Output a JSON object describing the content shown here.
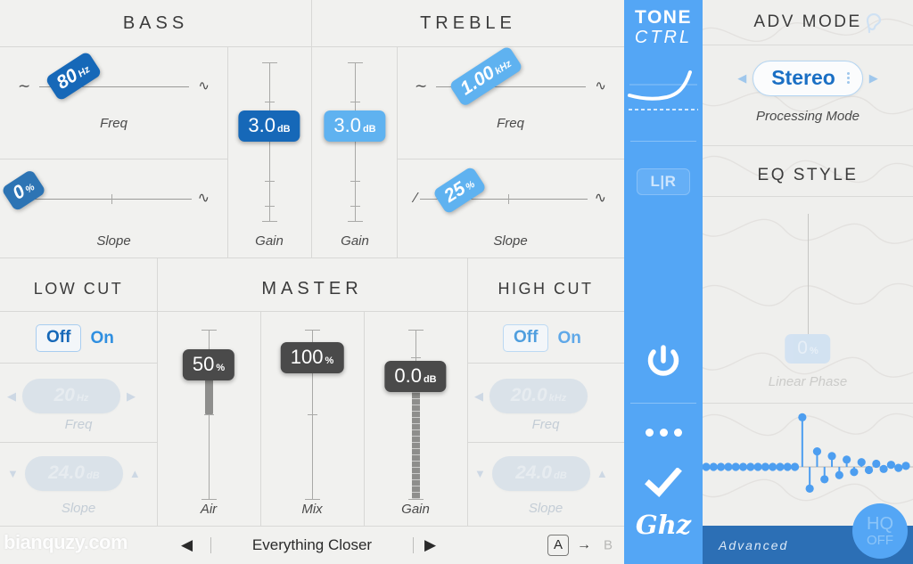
{
  "bass": {
    "title": "BASS",
    "freq": {
      "value": "80",
      "unit": "Hz",
      "label": "Freq",
      "pos_pct": 18
    },
    "slope": {
      "value": "0",
      "unit": "%",
      "label": "Slope",
      "pos_pct": 1
    },
    "gain": {
      "value": "3.0",
      "unit": "dB",
      "label": "Gain",
      "pos_pct": 62
    },
    "accent": "#1668b8"
  },
  "treble": {
    "title": "TREBLE",
    "freq": {
      "value": "1.00",
      "unit": "kHz",
      "label": "Freq",
      "pos_pct": 25
    },
    "slope": {
      "value": "25",
      "unit": "%",
      "label": "Slope",
      "pos_pct": 24
    },
    "gain": {
      "value": "3.0",
      "unit": "dB",
      "label": "Gain",
      "pos_pct": 62
    },
    "accent": "#5fb2f0"
  },
  "lowcut": {
    "title": "LOW CUT",
    "toggle": {
      "off": "Off",
      "on": "On",
      "selected": "Off"
    },
    "freq": {
      "value": "20",
      "unit": "Hz",
      "label": "Freq",
      "left_arrow": "◀",
      "right_arrow": "▶"
    },
    "slope": {
      "value": "24.0",
      "unit": "dB",
      "label": "Slope",
      "left_arrow": "▼",
      "right_arrow": "▲"
    }
  },
  "highcut": {
    "title": "HIGH CUT",
    "toggle": {
      "off": "Off",
      "on": "On",
      "selected": "Off"
    },
    "freq": {
      "value": "20.0",
      "unit": "kHz",
      "label": "Freq",
      "left_arrow": "◀",
      "right_arrow": "▶"
    },
    "slope": {
      "value": "24.0",
      "unit": "dB",
      "label": "Slope",
      "left_arrow": "▼",
      "right_arrow": "▲"
    }
  },
  "master": {
    "title": "MASTER",
    "accent": "#4a4a4a",
    "air": {
      "value": "50",
      "unit": "%",
      "label": "Air",
      "pos_pct": 50
    },
    "mix": {
      "value": "100",
      "unit": "%",
      "label": "Mix",
      "pos_pct": 100
    },
    "gain": {
      "value": "0.0",
      "unit": "dB",
      "label": "Gain",
      "pos_pct": 84
    }
  },
  "center": {
    "title_line1": "TONE",
    "title_line2": "CTRL",
    "lr_button": "L|R",
    "power_icon": "power-icon",
    "menu_icon": "more-dots-icon",
    "check_icon": "checkmark-icon",
    "logo": "Ghz",
    "bg": "#54a6f5"
  },
  "advmode": {
    "title": "ADV MODE",
    "ear_icon": "ear-icon",
    "mode_value": "Stereo",
    "mode_label": "Processing Mode",
    "left_arrow": "◀",
    "right_arrow": "▶"
  },
  "eqstyle": {
    "title": "EQ STYLE",
    "linear_phase": {
      "value": "0",
      "unit": "%",
      "label": "Linear Phase"
    }
  },
  "impulse": {
    "label": "impulse-response-plot",
    "dot_color": "#4d9ef0",
    "stems": [
      0,
      0,
      0,
      0,
      0,
      0,
      0,
      0,
      0,
      0,
      0,
      0,
      0,
      0.96,
      -0.42,
      0.3,
      -0.24,
      0.21,
      -0.16,
      0.14,
      -0.1,
      0.09,
      -0.06,
      0.06,
      -0.04,
      0.04,
      -0.02,
      0.02
    ]
  },
  "footer_right": {
    "advanced_label": "Advanced",
    "hq_line1": "HQ",
    "hq_line2": "OFF"
  },
  "bottom_bar": {
    "prev": "◀",
    "next": "▶",
    "preset_name": "Everything Closer",
    "a_label": "A",
    "arrow": "→",
    "b_label": "B",
    "watermark": "bianquzy.com"
  }
}
